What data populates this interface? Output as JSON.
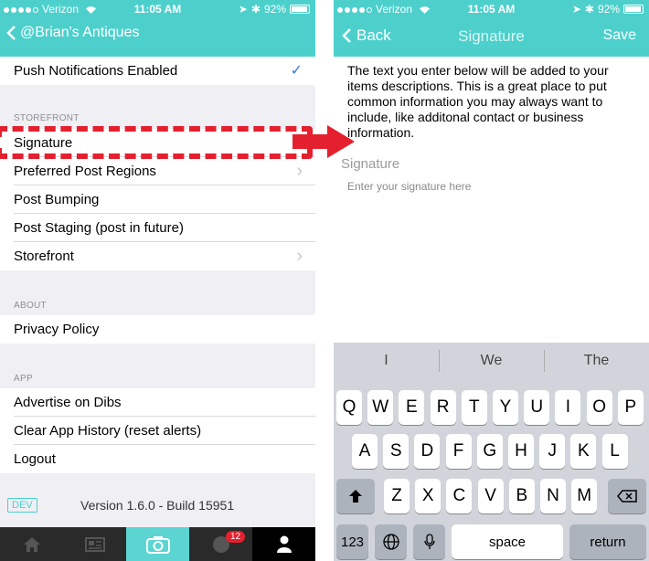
{
  "status": {
    "carrier": "Verizon",
    "time": "11:05 AM",
    "battery": "92%"
  },
  "left": {
    "back_label": "@Brian's Antiques",
    "push_row": "Push Notifications Enabled",
    "check": "✓",
    "sections": {
      "storefront": "STOREFRONT",
      "about": "ABOUT",
      "app": "APP"
    },
    "storefront_items": [
      "Signature",
      "Preferred Post Regions",
      "Post Bumping",
      "Post Staging (post in future)",
      "Storefront"
    ],
    "about_items": [
      "Privacy Policy"
    ],
    "app_items": [
      "Advertise on Dibs",
      "Clear App History (reset alerts)",
      "Logout"
    ],
    "dev_badge": "DEV",
    "version": "Version 1.6.0 - Build 15951",
    "badge_count": "12"
  },
  "right": {
    "back_label": "Back",
    "title": "Signature",
    "save_label": "Save",
    "description": "The text you enter below will be added to your items descriptions. This is a great place to put common information you may always want to include, like additonal contact or business information.",
    "field_label": "Signature",
    "field_placeholder": "Enter your signature here",
    "suggestions": [
      "I",
      "We",
      "The"
    ],
    "keyboard": {
      "row1": [
        "Q",
        "W",
        "E",
        "R",
        "T",
        "Y",
        "U",
        "I",
        "O",
        "P"
      ],
      "row2": [
        "A",
        "S",
        "D",
        "F",
        "G",
        "H",
        "J",
        "K",
        "L"
      ],
      "row3": [
        "Z",
        "X",
        "C",
        "V",
        "B",
        "N",
        "M"
      ],
      "numbers": "123",
      "space": "space",
      "return": "return"
    }
  },
  "colors": {
    "accent": "#4dd0cc",
    "highlight": "#e5202e",
    "arrow": "#e5202e"
  }
}
